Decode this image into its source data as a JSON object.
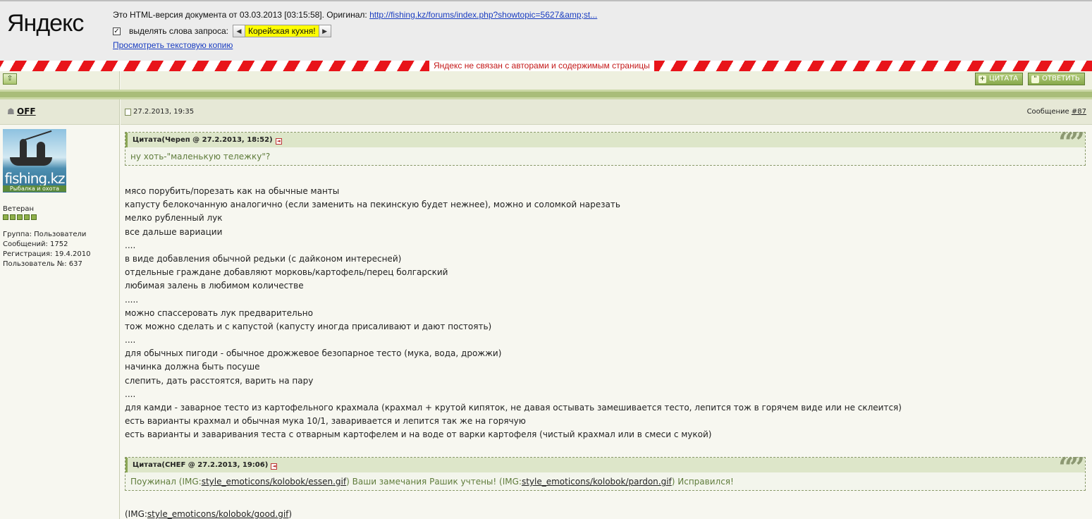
{
  "yandex": {
    "logo": "Яндекс",
    "cache_prefix": "Это HTML-версия документа от 03.03.2013 [03:15:58].  Оригинал: ",
    "original_url": "http://fishing.kz/forums/index.php?showtopic=5627&amp;st...",
    "highlight_label": "выделять слова запроса:",
    "highlight_checked": "✓",
    "query": "Корейская кухня!",
    "text_copy_link": "Просмотреть текстовую копию",
    "disclaimer": "Яндекс не связан с авторами и содержимым страницы",
    "accent_color": "#e8141a"
  },
  "toolbar": {
    "up_icon": "up-arrow-icon",
    "quote_label": "ЦИТАТА",
    "reply_label": "ОТВЕТИТЬ"
  },
  "post": {
    "author": "OFF",
    "date": "27.2.2013, 19:35",
    "message_label": "Сообщение ",
    "message_number": "#87",
    "avatar_brand": "fishing.kz",
    "avatar_caption": "Рыбалка и охота",
    "rank": "Ветеран",
    "rank_pips": 5,
    "group": "Группа: Пользователи",
    "messages": "Сообщений: 1752",
    "registered": "Регистрация: 19.4.2010",
    "user_number": "Пользователь №: 637",
    "quote1": {
      "title": "Цитата(Череп @ 27.2.2013, 18:52)",
      "text": "ну хоть-\"маленькую тележку\"?"
    },
    "lines": [
      "мясо порубить/порезать как на обычные манты",
      "капусту белокочанную аналогично (если заменить на пекинскую будет нежнее), можно и соломкой нарезать",
      "мелко рубленный лук",
      "все дальше вариации",
      "....",
      "в виде добавления обычной редьки (с дайконом интересней)",
      "отдельные граждане добавляют морковь/картофель/перец болгарский",
      "любимая залень в любимом количестве",
      ".....",
      "можно спассеровать лук предварительно",
      "тож можно сделать и с капустой (капусту иногда присаливают и дают постоять)",
      "....",
      "для обычных пигоди - обычное дрожжевое безопарное тесто (мука, вода, дрожжи)",
      "начинка должна быть посуше",
      "слепить, дать расстоятся, варить на пару",
      "....",
      "для камди - заварное тесто из картофельного крахмала (крахмал + крутой кипяток, не давая остывать замешивается тесто, лепится тож в горячем виде или не склеится)",
      "есть варианты крахмал и обычная мука 10/1, заваривается и лепится так же на горячую",
      "есть варианты и заваривания теста с отварным картофелем и на воде от варки картофеля (чистый крахмал или в смеси с мукой)"
    ],
    "quote2": {
      "title": "Цитата(CHEF @ 27.2.2013, 19:06)",
      "t1": "Поужинал (IMG:",
      "l1": "style_emoticons/kolobok/essen.gif",
      "t2": ") Ваши замечания Рашик учтены! (IMG:",
      "l2": "style_emoticons/kolobok/pardon.gif",
      "t3": ") Исправился!"
    },
    "tail_prefix": "(IMG:",
    "tail_link": "style_emoticons/kolobok/good.gif",
    "tail_suffix": ")"
  }
}
